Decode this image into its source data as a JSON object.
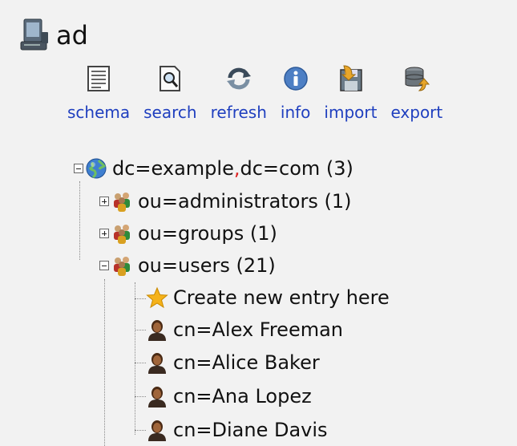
{
  "server": {
    "name": "ad",
    "icon": "server-computer-icon"
  },
  "toolbar": [
    {
      "label": "schema",
      "icon": "schema-document-icon"
    },
    {
      "label": "search",
      "icon": "search-magnifier-icon"
    },
    {
      "label": "refresh",
      "icon": "refresh-arrows-icon"
    },
    {
      "label": "info",
      "icon": "info-circle-icon"
    },
    {
      "label": "import",
      "icon": "import-disk-icon"
    },
    {
      "label": "export",
      "icon": "export-database-icon"
    }
  ],
  "tree": {
    "root": {
      "part1": "dc=example",
      "comma": ",",
      "part2": "dc=com",
      "count": "(3)"
    },
    "ous": [
      {
        "label": "ou=administrators (1)",
        "expanded": false
      },
      {
        "label": "ou=groups (1)",
        "expanded": false
      },
      {
        "label": "ou=users (21)",
        "expanded": true
      }
    ],
    "create_label": "Create new entry here",
    "users": [
      "cn=Alex Freeman",
      "cn=Alice Baker",
      "cn=Ana Lopez",
      "cn=Diane Davis"
    ]
  },
  "colors": {
    "link": "#1f3fbf",
    "comma": "#dd2222",
    "background": "#f2f2f2"
  }
}
